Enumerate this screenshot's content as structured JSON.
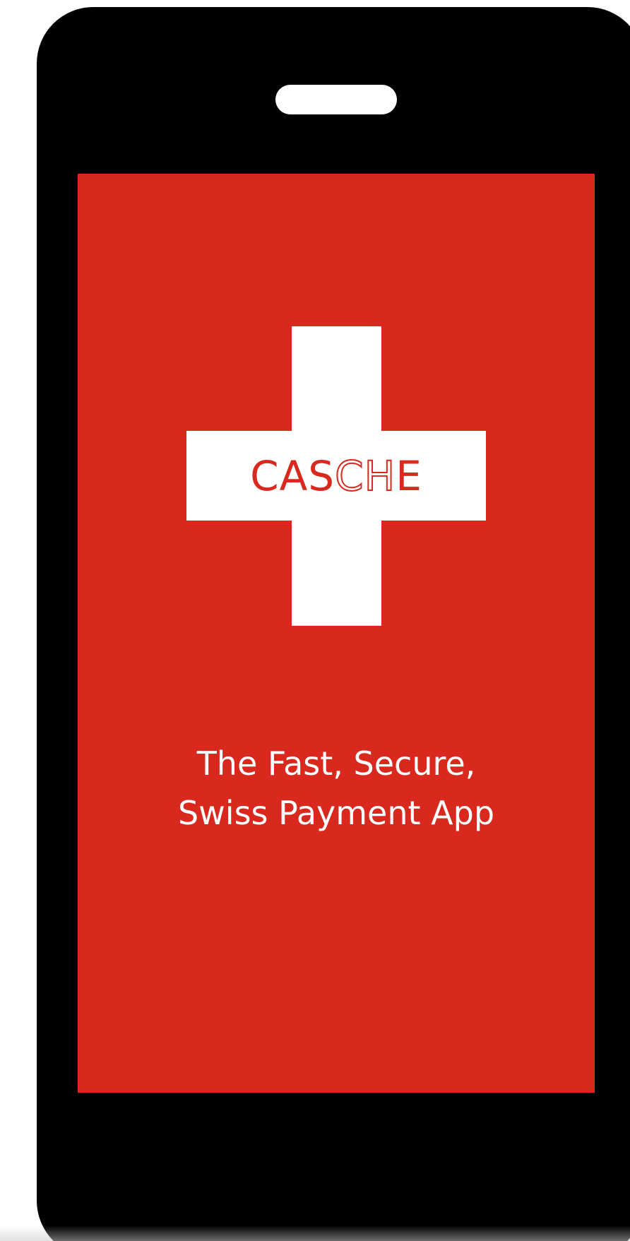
{
  "logo": {
    "part1": "CAS",
    "part2": "CH",
    "part3": "E"
  },
  "tagline": {
    "line1": "The Fast, Secure,",
    "line2": "Swiss Payment App"
  },
  "colors": {
    "screen_background": "#d9291f",
    "cross": "#ffffff",
    "phone_body": "#000000",
    "text": "#ffffff"
  },
  "icons": {
    "cross": "swiss-cross-icon",
    "speaker": "speaker-slot-icon"
  }
}
